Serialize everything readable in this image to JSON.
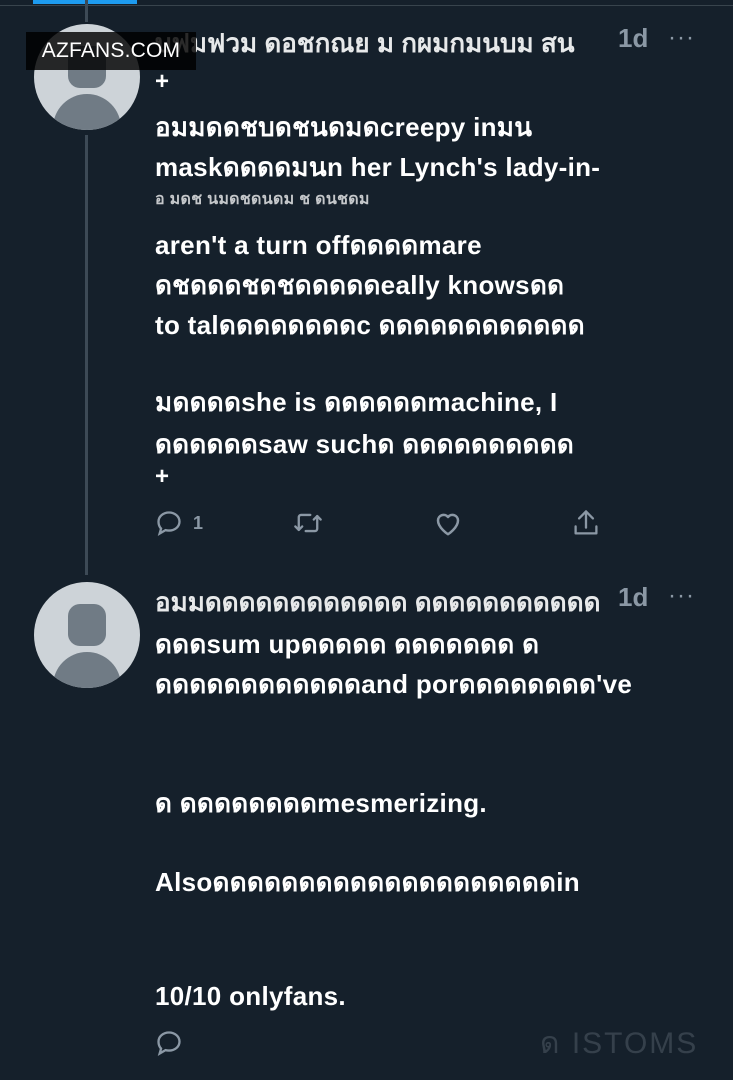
{
  "watermark": "AZFANS.COM",
  "tweets": [
    {
      "header": "บฟมฟวม ดอชกณย ม กผมกมนบม สน",
      "time": "1d",
      "more_icon": "more-horizontal-icon",
      "lines": [
        "อมมดดชบดชนดมดcreepy inมน",
        "maskดดดดมนn her Lynch's lady-in-",
        "อ มดช นมดชดนดม ช ดนชดม",
        "aren't a turn offดดดดmare",
        "ดชดดดชดชดดดดดeally knowsดด",
        "to talดดดดดดดดc ดดดดดดดดดดดด",
        "มดดดดshe is ดดดดดดmachine, I",
        "ดดดดดดsaw suchด ดดดดดดดดดด"
      ],
      "plus_top": "+",
      "plus_bottom": "+",
      "actions": {
        "reply_icon": "reply-icon",
        "reply_count": "1",
        "retweet_icon": "retweet-icon",
        "like_icon": "like-icon",
        "share_icon": "share-icon"
      }
    },
    {
      "header": "อมมดดดดดดดดดดดด ดดดดดดดดดดด",
      "time": "1d",
      "more_icon": "more-horizontal-icon",
      "lines": [
        "ดดดsum upดดดดด ดดดดดดด ด",
        "ดดดดดดดดดดดดand porดดดดดดดด've",
        "ด ดดดดดดดดmesmerizing.",
        "Alsoดดดดดดดดดดดดดดดดดดดดin",
        "10/10 onlyfans."
      ],
      "actions": {
        "reply_icon": "reply-icon"
      }
    }
  ],
  "footer_blur": "ด ISTOMS"
}
